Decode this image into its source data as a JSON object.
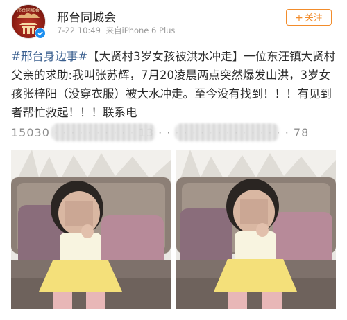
{
  "account": {
    "name": "邢台同城会",
    "avatar_logo_text": "邢台同城会",
    "timestamp": "7-22 10:49",
    "source": "来自iPhone 6 Plus"
  },
  "follow_button": {
    "icon": "+",
    "label": "关注"
  },
  "post": {
    "hashtag": "#邢台身边事#",
    "body": "【大贤村3岁女孩被洪水冲走】一位东汪镇大贤村父亲的求助:我叫张苏辉，7月20凌晨两点突然爆发山洪，3岁女孩张梓阳（没穿衣服）被大水冲走。至今没有找到！！！有见到者帮忙救起！！！联系电",
    "contact_partial": "15030 · · · · · · · · · · 13 · · · · · · · · · · · · · · · · 78"
  },
  "photos": [
    {
      "subject": "child-photo-left",
      "blurred_face": true
    },
    {
      "subject": "child-photo-right",
      "blurred_face": true
    }
  ],
  "colors": {
    "follow_accent": "#f28c2b",
    "hashtag": "#3a5f8f",
    "verified_badge": "#1d8ff0",
    "avatar_bg": "#c0392b"
  },
  "icons": {
    "verified": "verified-badge-icon",
    "avatar_gate": "pagoda-gate-icon"
  }
}
